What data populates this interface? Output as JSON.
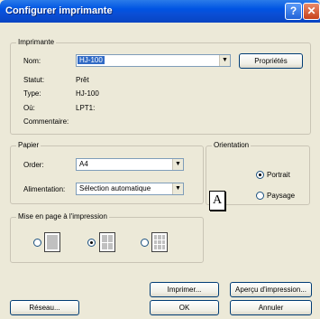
{
  "window": {
    "title": "Configurer imprimante",
    "help": "?",
    "close": "✕"
  },
  "printer": {
    "group_label": "Imprimante",
    "name_label": "Nom:",
    "name_value": "HJ-100",
    "properties_button": "Propriétés",
    "status_label": "Statut:",
    "status_value": "Prêt",
    "type_label": "Type:",
    "type_value": "HJ-100",
    "where_label": "Où:",
    "where_value": "LPT1:",
    "comment_label": "Commentaire:"
  },
  "paper": {
    "group_label": "Papier",
    "order_label": "Order:",
    "order_value": "A4",
    "feed_label": "Alimentation:",
    "feed_value": "Sélection automatique"
  },
  "orientation": {
    "group_label": "Orientation",
    "icon_letter": "A",
    "portrait": "Portrait",
    "landscape": "Paysage",
    "selected": "portrait"
  },
  "layout": {
    "group_label": "Mise en page à l'impression",
    "options": [
      "1 page",
      "4 pages",
      "9 pages"
    ],
    "selected_index": 1
  },
  "buttons": {
    "print": "Imprimer...",
    "preview": "Aperçu d'impression...",
    "network": "Réseau...",
    "ok": "OK",
    "cancel": "Annuler"
  }
}
